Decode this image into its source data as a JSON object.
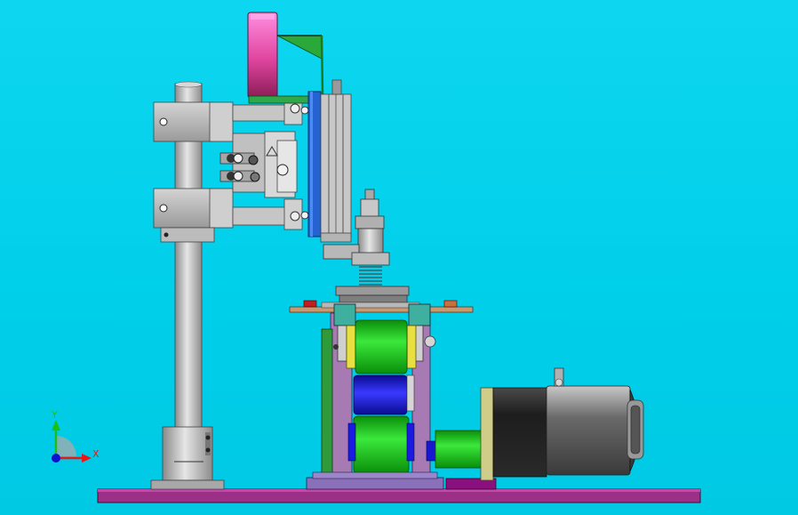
{
  "axes_triad": {
    "x_label": "X",
    "y_label": "Y",
    "x_color": "#e81818",
    "y_color": "#18c018",
    "z_color": "#1010d0"
  },
  "colors": {
    "background": "#00d3ee",
    "base_plate": "#a0308a",
    "column": "#b8b8b8",
    "bracket": "#bdbdbd",
    "pink_wheel": "#ff7ed2",
    "blue_plate": "#2266dd",
    "green_roller": "#18c818",
    "blue_roller": "#1818e0",
    "motor_body": "#7a7a7a",
    "motor_flange": "#c8c890",
    "coupling": "#22d022",
    "purple_frame": "#a070b0",
    "teal_block": "#40b0a0"
  }
}
